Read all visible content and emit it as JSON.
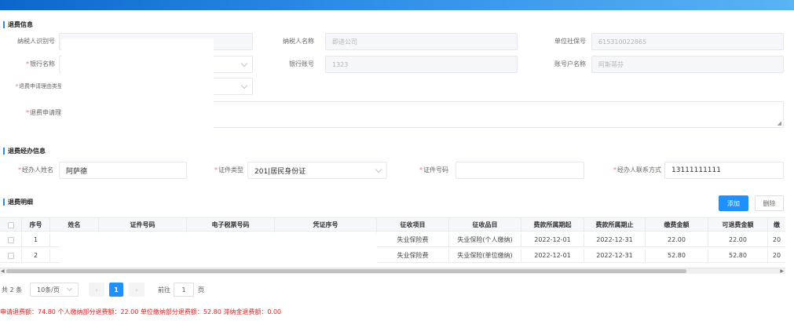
{
  "sections": {
    "refund_info": "退费信息",
    "agent_info": "退费经办信息",
    "detail": "退费明细"
  },
  "refund_info": {
    "taxpayer_id_label": "纳税人识别号",
    "taxpayer_name_label": "纳税人名称",
    "taxpayer_name_value": "即进公司",
    "unit_social_label": "单位社保号",
    "unit_social_value": "615310022865",
    "bank_name_label": "银行名称",
    "bank_account_label": "银行账号",
    "bank_account_value": "1323",
    "account_name_label": "账号户名称",
    "account_name_value": "阿斯蒂芬",
    "reason_type_label": "退费申请理由类型",
    "reason_label": "退费申请理由"
  },
  "agent_info": {
    "name_label": "经办人姓名",
    "name_value": "阿萨德",
    "id_type_label": "证件类型",
    "id_type_value": "201|居民身份证",
    "id_no_label": "证件号码",
    "contact_label": "经办人联系方式",
    "contact_value": "13111111111"
  },
  "actions": {
    "add": "添加",
    "delete": "删除"
  },
  "table": {
    "headers": [
      "序号",
      "姓名",
      "证件号码",
      "电子税票号码",
      "凭证序号",
      "征收项目",
      "征收品目",
      "费款所属期起",
      "费款所属期止",
      "缴费金额",
      "可退费金额",
      "缴"
    ],
    "rows": [
      {
        "seq": "1",
        "item": "失业保险费",
        "sub": "失业保险(个人缴纳)",
        "start": "2022-12-01",
        "end": "2022-12-31",
        "amount": "22.00",
        "refundable": "22.00",
        "extra": "20"
      },
      {
        "seq": "2",
        "item": "失业保险费",
        "sub": "失业保险(单位缴纳)",
        "start": "2022-12-01",
        "end": "2022-12-31",
        "amount": "52.80",
        "refundable": "52.80",
        "extra": "20"
      }
    ]
  },
  "pager": {
    "total": "共 2 条",
    "size": "10条/页",
    "current": "1",
    "goto_prefix": "前往",
    "goto_value": "1",
    "goto_suffix": "页"
  },
  "summary": "申请退费额：74.80   个人缴纳部分退费额：22.00   单位缴纳部分退费额：52.80   滞纳金退费额：0.00",
  "colors": {
    "accent": "#1e90ff",
    "required": "#f56c6c",
    "summary": "#e02020"
  }
}
